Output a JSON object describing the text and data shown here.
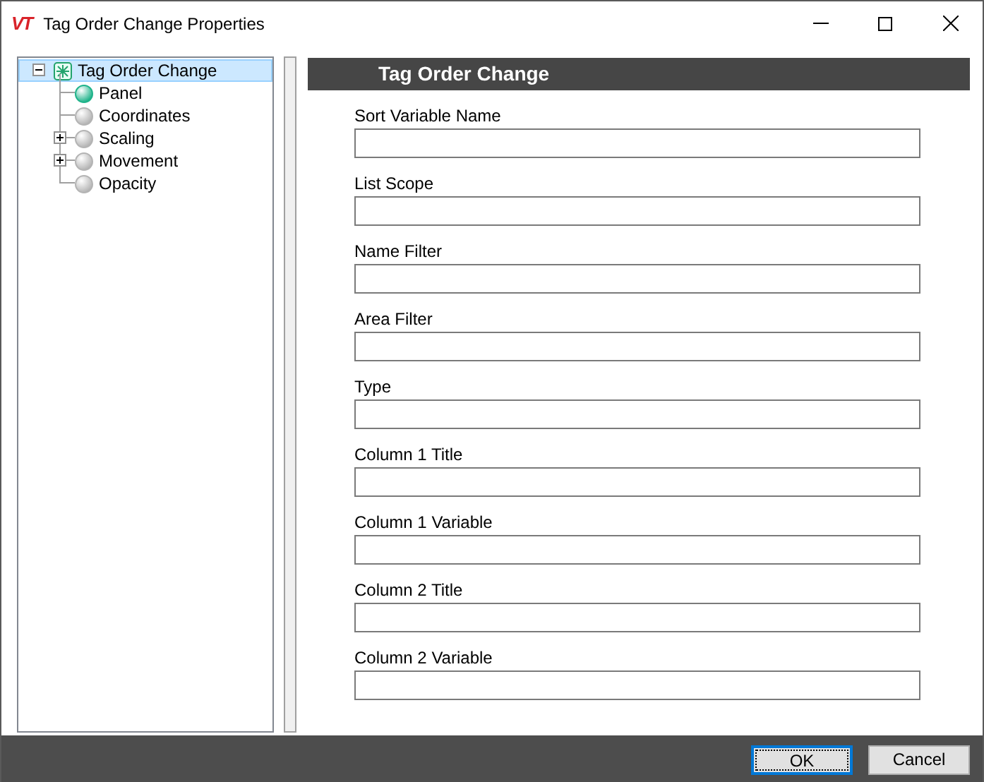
{
  "window": {
    "logo": "VT",
    "title": "Tag Order Change Properties"
  },
  "tree": [
    {
      "label": "Tag Order Change",
      "expanded": true,
      "selected": true,
      "children": [
        {
          "label": "Panel",
          "color": "#1fb38a",
          "selected": false
        },
        {
          "label": "Coordinates",
          "color": "#b4b4b4",
          "selected": false
        },
        {
          "label": "Scaling",
          "color": "#b4b4b4",
          "selected": false,
          "expanded": false
        },
        {
          "label": "Movement",
          "color": "#b4b4b4",
          "selected": false,
          "expanded": false
        },
        {
          "label": "Opacity",
          "color": "#b4b4b4",
          "selected": false
        }
      ]
    }
  ],
  "panel": {
    "header": "Tag Order Change",
    "fields": [
      {
        "label": "Sort Variable Name"
      },
      {
        "label": "List Scope"
      },
      {
        "label": "Name Filter"
      },
      {
        "label": "Area Filter"
      },
      {
        "label": "Type"
      },
      {
        "label": "Column 1 Title"
      },
      {
        "label": "Column 1 Variable"
      },
      {
        "label": "Column 2 Title"
      },
      {
        "label": "Column 2 Variable"
      }
    ]
  },
  "buttons": [
    {
      "label": "OK",
      "focused": true
    },
    {
      "label": "Cancel",
      "focused": false
    }
  ]
}
